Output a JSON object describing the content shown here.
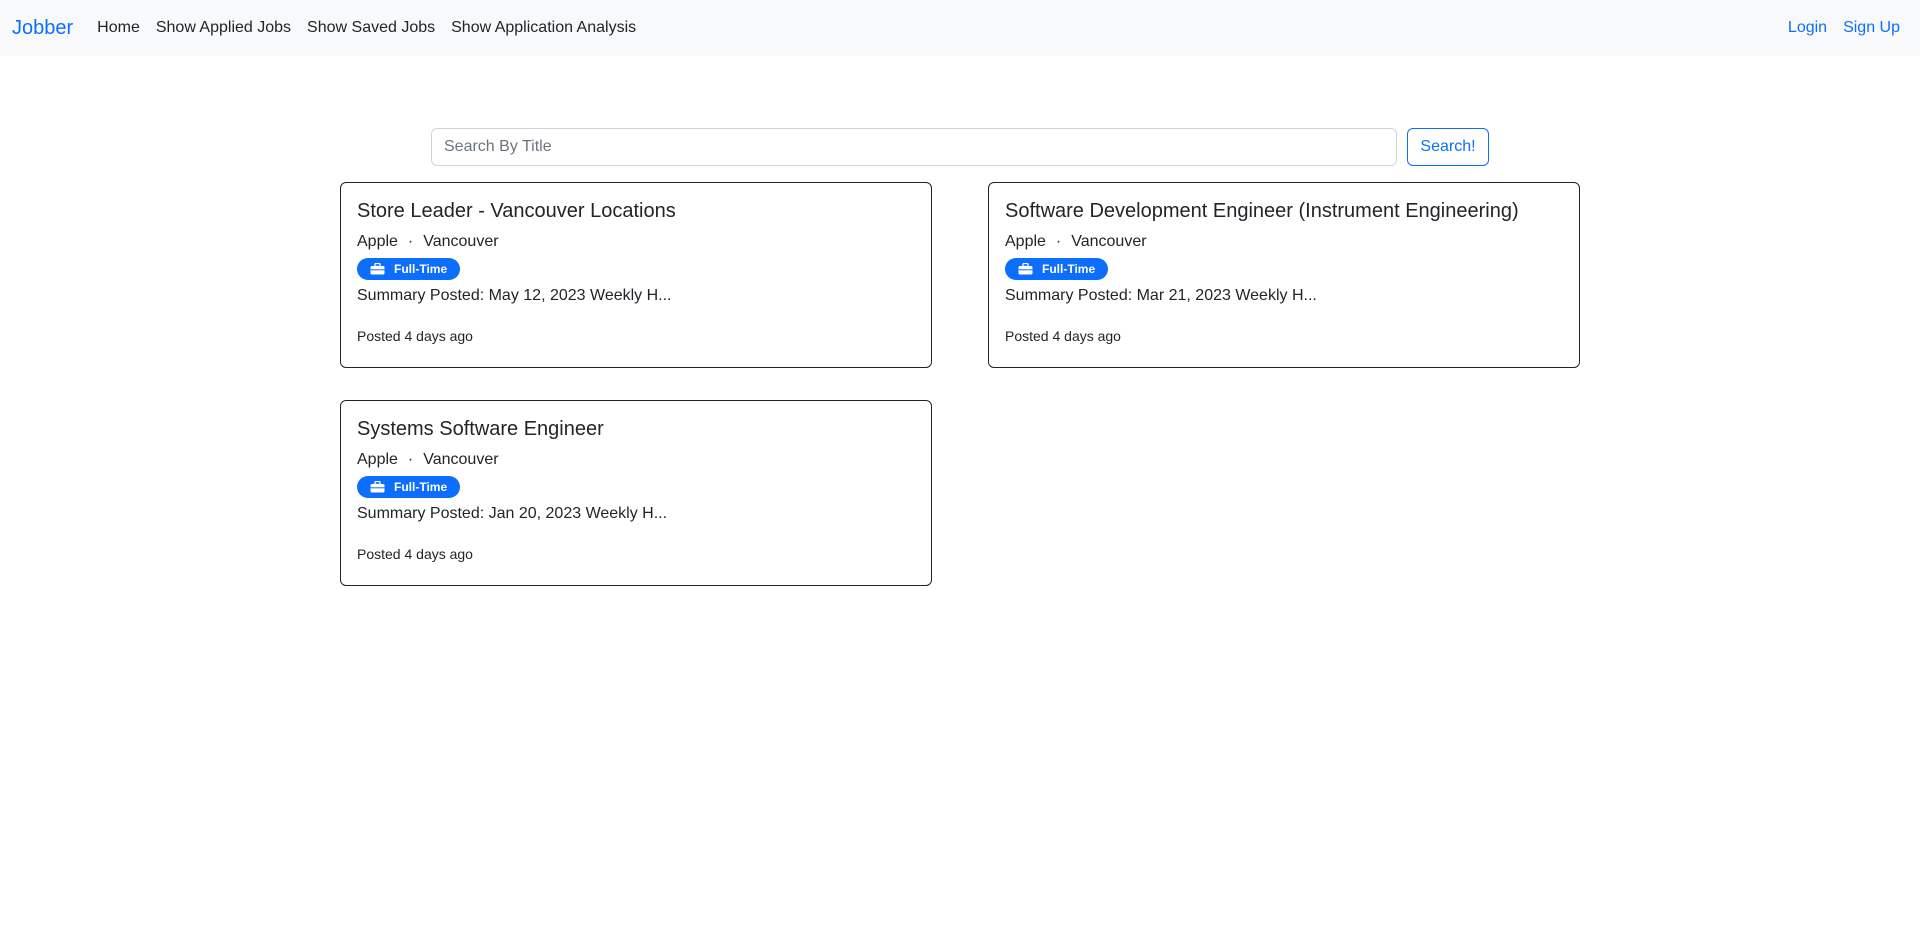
{
  "navbar": {
    "brand": "Jobber",
    "links": [
      "Home",
      "Show Applied Jobs",
      "Show Saved Jobs",
      "Show Application Analysis"
    ],
    "login": "Login",
    "signup": "Sign Up"
  },
  "search": {
    "placeholder": "Search By Title",
    "value": "",
    "button_label": "Search!"
  },
  "jobs": [
    {
      "title": "Store Leader - Vancouver Locations",
      "company": "Apple",
      "separator": "·",
      "location": "Vancouver",
      "type": "Full-Time",
      "summary": "Summary Posted: May 12, 2023 Weekly H...",
      "posted": "Posted 4 days ago"
    },
    {
      "title": "Software Development Engineer (Instrument Engineering)",
      "company": "Apple",
      "separator": "·",
      "location": "Vancouver",
      "type": "Full-Time",
      "summary": "Summary Posted: Mar 21, 2023 Weekly H...",
      "posted": "Posted 4 days ago"
    },
    {
      "title": "Systems Software Engineer",
      "company": "Apple",
      "separator": "·",
      "location": "Vancouver",
      "type": "Full-Time",
      "summary": "Summary Posted: Jan 20, 2023 Weekly H...",
      "posted": "Posted 4 days ago"
    }
  ],
  "colors": {
    "primary": "#0d6efd",
    "navbar_bg": "#f8f9fa",
    "text": "#212529"
  },
  "icons": {
    "job_type": "briefcase-icon"
  }
}
